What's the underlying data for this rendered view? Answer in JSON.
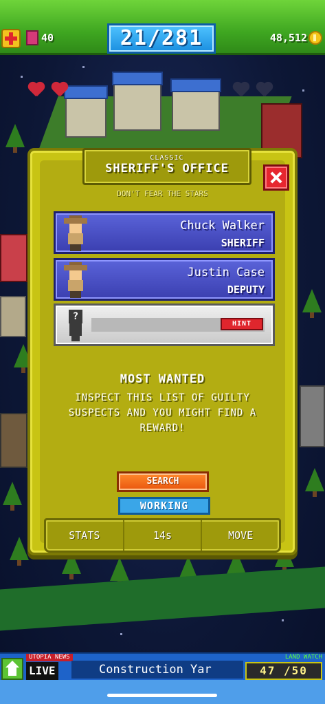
{
  "topbar": {
    "book_count": "40",
    "progress": "21/281",
    "coins": "48,512"
  },
  "dialog": {
    "category": "CLASSIC",
    "title": "SHERIFF'S OFFICE",
    "tagline": "DON'T FEAR THE STARS",
    "residents": [
      {
        "name": "Chuck Walker",
        "role": "SHERIFF"
      },
      {
        "name": "Justin Case",
        "role": "DEPUTY"
      }
    ],
    "empty_slot": {
      "hint_label": "HINT"
    },
    "info_heading": "MOST WANTED",
    "info_body": "INSPECT THIS LIST OF GUILTY SUSPECTS AND YOU MIGHT FIND A REWARD!",
    "search_label": "SEARCH",
    "status_label": "WORKING",
    "footer": {
      "stats": "STATS",
      "timer": "14s",
      "move": "MOVE"
    }
  },
  "ticker": {
    "news_tag": "UTOPIA NEWS",
    "live": "LIVE",
    "headline": "Construction Yar",
    "land_watch_tag": "LAND WATCH",
    "land_count": "47 /50"
  },
  "colors": {
    "accent_green": "#3fa721",
    "dialog_yellow": "#c8c414",
    "resident_blue": "#3b3fb0",
    "close_red": "#e6262f"
  }
}
